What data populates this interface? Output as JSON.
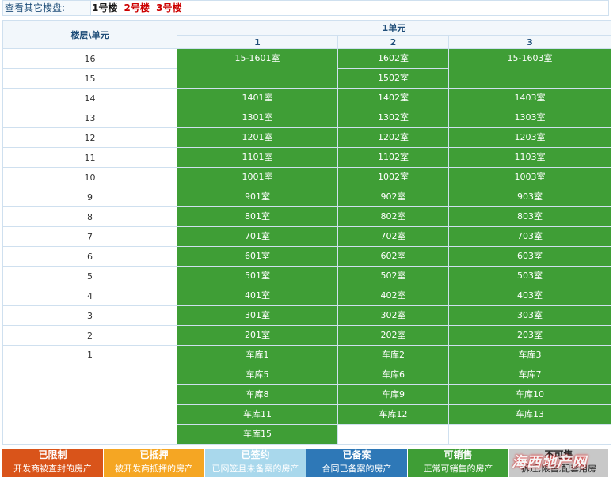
{
  "nav": {
    "label": "查看其它楼盘:",
    "buildings": [
      {
        "label": "1号楼",
        "current": true
      },
      {
        "label": "2号楼",
        "current": false
      },
      {
        "label": "3号楼",
        "current": false
      }
    ]
  },
  "table": {
    "corner_header": "楼层\\单元",
    "unit_header": "1单元",
    "columns": [
      "1",
      "2",
      "3"
    ]
  },
  "floors": {
    "f16": "16",
    "f15": "15",
    "f14": "14",
    "f13": "13",
    "f12": "12",
    "f11": "11",
    "f10": "10",
    "f9": "9",
    "f8": "8",
    "f7": "7",
    "f6": "6",
    "f5": "5",
    "f4": "4",
    "f3": "3",
    "f2": "2",
    "f1": "1"
  },
  "rooms": {
    "r16_1": "15-1601室",
    "r16_2": "1602室",
    "r16_3": "15-1603室",
    "r15_2": "1502室",
    "r14_1": "1401室",
    "r14_2": "1402室",
    "r14_3": "1403室",
    "r13_1": "1301室",
    "r13_2": "1302室",
    "r13_3": "1303室",
    "r12_1": "1201室",
    "r12_2": "1202室",
    "r12_3": "1203室",
    "r11_1": "1101室",
    "r11_2": "1102室",
    "r11_3": "1103室",
    "r10_1": "1001室",
    "r10_2": "1002室",
    "r10_3": "1003室",
    "r9_1": "901室",
    "r9_2": "902室",
    "r9_3": "903室",
    "r8_1": "801室",
    "r8_2": "802室",
    "r8_3": "803室",
    "r7_1": "701室",
    "r7_2": "702室",
    "r7_3": "703室",
    "r6_1": "601室",
    "r6_2": "602室",
    "r6_3": "603室",
    "r5_1": "501室",
    "r5_2": "502室",
    "r5_3": "503室",
    "r4_1": "401室",
    "r4_2": "402室",
    "r4_3": "403室",
    "r3_1": "301室",
    "r3_2": "302室",
    "r3_3": "303室",
    "r2_1": "201室",
    "r2_2": "202室",
    "r2_3": "203室"
  },
  "garages": {
    "g1": "车库1",
    "g2": "车库2",
    "g3": "车库3",
    "g5": "车库5",
    "g6": "车库6",
    "g7": "车库7",
    "g8": "车库8",
    "g9": "车库9",
    "g10": "车库10",
    "g11": "车库11",
    "g12": "车库12",
    "g13": "车库13",
    "g15": "车库15"
  },
  "legend": [
    {
      "title": "已限制",
      "desc": "开发商被查封的房产",
      "color": "#d9541a"
    },
    {
      "title": "已抵押",
      "desc": "被开发商抵押的房产",
      "color": "#f5a623"
    },
    {
      "title": "已签约",
      "desc": "已网签且未备案的房产",
      "color": "#a9d8ec"
    },
    {
      "title": "已备案",
      "desc": "合同已备案的房产",
      "color": "#2e78b7"
    },
    {
      "title": "可销售",
      "desc": "正常可销售的房产",
      "color": "#3f9e36"
    },
    {
      "title": "不可售",
      "desc": "拆迁,限售,配套用房",
      "color": "#c8c8c8"
    }
  ],
  "watermark": "海西地产网",
  "colors": {
    "available": "#3f9e36",
    "border": "#cfe0ef",
    "header_text": "#1f4e79"
  }
}
